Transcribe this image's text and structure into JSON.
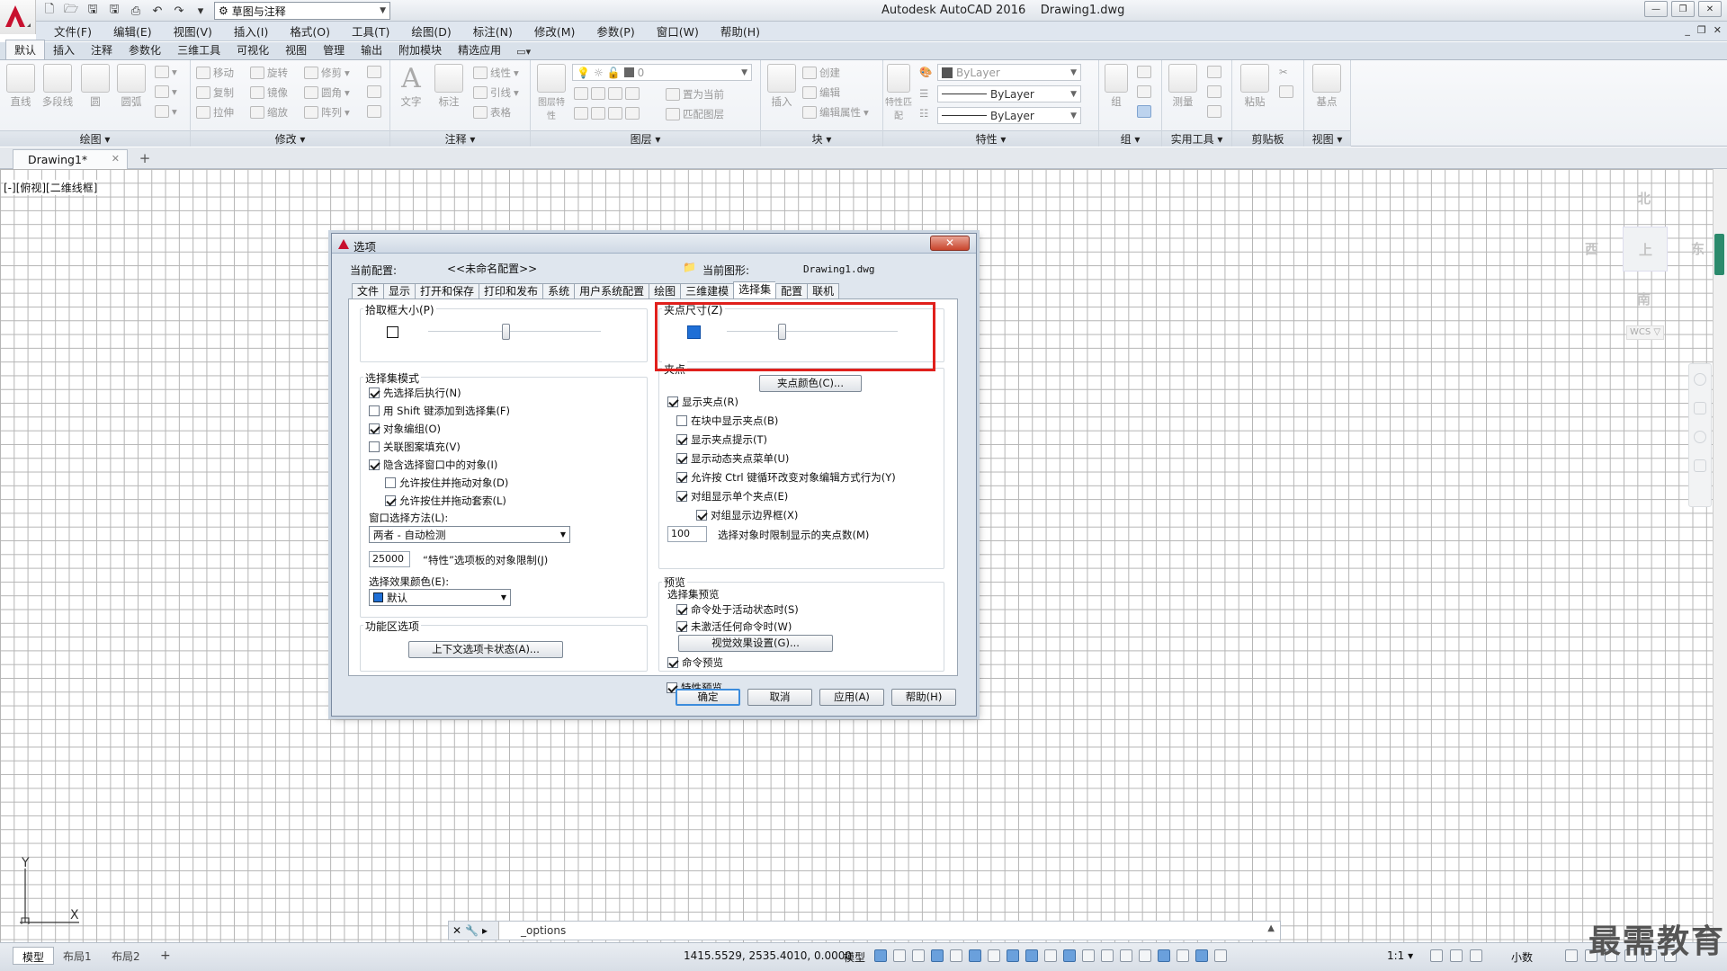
{
  "app": {
    "title": "Autodesk AutoCAD 2016    Drawing1.dwg",
    "workspace": "草图与注释"
  },
  "menubar": [
    "文件(F)",
    "编辑(E)",
    "视图(V)",
    "插入(I)",
    "格式(O)",
    "工具(T)",
    "绘图(D)",
    "标注(N)",
    "修改(M)",
    "参数(P)",
    "窗口(W)",
    "帮助(H)"
  ],
  "ribbon": {
    "tabs": [
      "默认",
      "插入",
      "注释",
      "参数化",
      "三维工具",
      "可视化",
      "视图",
      "管理",
      "输出",
      "附加模块",
      "精选应用"
    ],
    "draw": {
      "line": "直线",
      "polyline": "多段线",
      "circle": "圆",
      "arc": "圆弧",
      "footer": "绘图 ▾"
    },
    "modify": {
      "move": "移动",
      "rotate": "旋转",
      "trim": "修剪",
      "copy": "复制",
      "mirror": "镜像",
      "fillet": "圆角",
      "stretch": "拉伸",
      "scale": "缩放",
      "array": "阵列",
      "footer": "修改 ▾"
    },
    "annotation": {
      "text": "文字",
      "dim": "标注",
      "linear": "线性",
      "leader": "引线",
      "table": "表格",
      "footer": "注释 ▾"
    },
    "layers": {
      "props": "图层特性",
      "layer_value": "0",
      "set_current": "置为当前",
      "match": "匹配图层",
      "footer": "图层 ▾"
    },
    "block": {
      "insert": "插入",
      "create": "创建",
      "edit": "编辑",
      "editattr": "编辑属性",
      "footer": "块 ▾"
    },
    "properties": {
      "match": "特性匹配",
      "color": "ByLayer",
      "linetype": "ByLayer",
      "lineweight": "ByLayer",
      "footer": "特性 ▾"
    },
    "groups": {
      "group": "组",
      "footer": "组 ▾"
    },
    "utilities": {
      "measure": "测量",
      "footer": "实用工具 ▾"
    },
    "clipboard": {
      "paste": "粘贴",
      "footer": "剪贴板"
    },
    "view": {
      "base": "基点",
      "footer": "视图 ▾"
    }
  },
  "filetabs": {
    "doc": "Drawing1*"
  },
  "viewport": {
    "label": "[-][俯视][二维线框]"
  },
  "viewcube": {
    "n": "北",
    "s": "南",
    "w": "西",
    "e": "东",
    "top": "上",
    "wcs": "WCS ▽"
  },
  "ucs": {
    "x": "X",
    "y": "Y"
  },
  "dialog": {
    "title": "选项",
    "profile_label": "当前配置:",
    "profile_value": "<<未命名配置>>",
    "drawing_label": "当前图形:",
    "drawing_value": "Drawing1.dwg",
    "tabs": [
      "文件",
      "显示",
      "打开和保存",
      "打印和发布",
      "系统",
      "用户系统配置",
      "绘图",
      "三维建模",
      "选择集",
      "配置",
      "联机"
    ],
    "pickbox": {
      "label": "拾取框大小(P)",
      "value": 0.45
    },
    "gripsize": {
      "label": "夹点尺寸(Z)",
      "value": 0.32
    },
    "selmodes": {
      "label": "选择集模式",
      "items": [
        {
          "text": "先选择后执行(N)",
          "checked": true
        },
        {
          "text": "用 Shift 键添加到选择集(F)",
          "checked": false
        },
        {
          "text": "对象编组(O)",
          "checked": true
        },
        {
          "text": "关联图案填充(V)",
          "checked": false
        },
        {
          "text": "隐含选择窗口中的对象(I)",
          "checked": true
        },
        {
          "text": "允许按住并拖动对象(D)",
          "checked": false
        },
        {
          "text": "允许按住并拖动套索(L)",
          "checked": true
        }
      ],
      "window_method_label": "窗口选择方法(L):",
      "window_method_value": "两者 - 自动检测",
      "limit_value": "25000",
      "limit_label": "“特性”选项板的对象限制(J)",
      "effect_color_label": "选择效果颜色(E):",
      "effect_color_value": "默认"
    },
    "ribbon_options": {
      "label": "功能区选项",
      "button": "上下文选项卡状态(A)..."
    },
    "grips": {
      "label": "夹点",
      "color_button": "夹点颜色(C)...",
      "items": [
        {
          "text": "显示夹点(R)",
          "checked": true
        },
        {
          "text": "在块中显示夹点(B)",
          "checked": false
        },
        {
          "text": "显示夹点提示(T)",
          "checked": true
        },
        {
          "text": "显示动态夹点菜单(U)",
          "checked": true
        },
        {
          "text": "允许按 Ctrl 键循环改变对象编辑方式行为(Y)",
          "checked": true
        },
        {
          "text": "对组显示单个夹点(E)",
          "checked": true
        },
        {
          "text": "对组显示边界框(X)",
          "checked": true
        }
      ],
      "limit_value": "100",
      "limit_label": "选择对象时限制显示的夹点数(M)"
    },
    "preview": {
      "label": "预览",
      "sub_label": "选择集预览",
      "items": [
        {
          "text": "命令处于活动状态时(S)",
          "checked": true
        },
        {
          "text": "未激活任何命令时(W)",
          "checked": true
        }
      ],
      "visual_button": "视觉效果设置(G)...",
      "cmd_preview": {
        "text": "命令预览",
        "checked": true
      },
      "prop_preview": {
        "text": "特性预览",
        "checked": true
      }
    },
    "buttons": {
      "ok": "确定",
      "cancel": "取消",
      "apply": "应用(A)",
      "help": "帮助(H)"
    }
  },
  "cmdline": {
    "text": "_options"
  },
  "statusbar": {
    "tabs": [
      "模型",
      "布局1",
      "布局2"
    ],
    "coords": "1415.5529, 2535.4010, 0.0000",
    "mode": "模型",
    "scale": "1:1 ▾",
    "units": "小数"
  },
  "watermark": "最需教育",
  "colors": {
    "accent": "#3c8cdc",
    "grip": "#1f6fd6",
    "highlight": "#e0201c"
  }
}
